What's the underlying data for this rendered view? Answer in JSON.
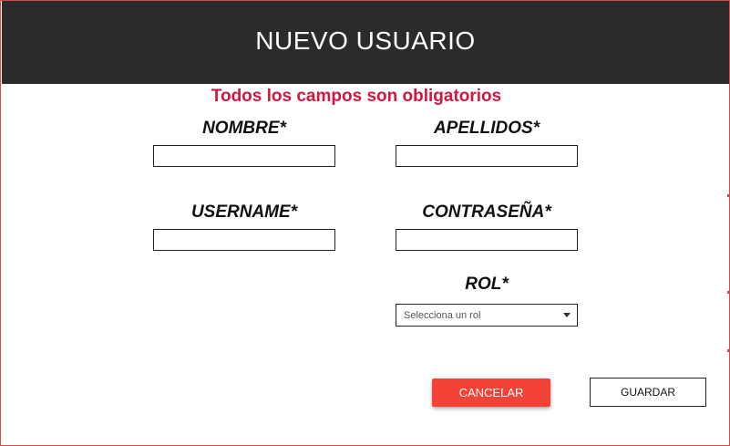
{
  "dialog": {
    "title": "NUEVO USUARIO",
    "notice": "Todos los campos son obligatorios"
  },
  "form": {
    "nombre": {
      "label": "NOMBRE*",
      "value": ""
    },
    "apellidos": {
      "label": "APELLIDOS*",
      "value": ""
    },
    "username": {
      "label": "USERNAME*",
      "value": ""
    },
    "contrasena": {
      "label": "CONTRASEÑA*",
      "value": ""
    },
    "rol": {
      "label": "ROL*",
      "selected": "Selecciona un rol"
    }
  },
  "actions": {
    "cancel_label": "CANCELAR",
    "save_label": "GUARDAR"
  },
  "colors": {
    "header_bg": "#2b2b2b",
    "notice_red": "#d2163e",
    "cancel_bg": "#f44336",
    "border_red": "#d94a4a"
  },
  "icons": {
    "select_caret": "caret-down-icon"
  }
}
